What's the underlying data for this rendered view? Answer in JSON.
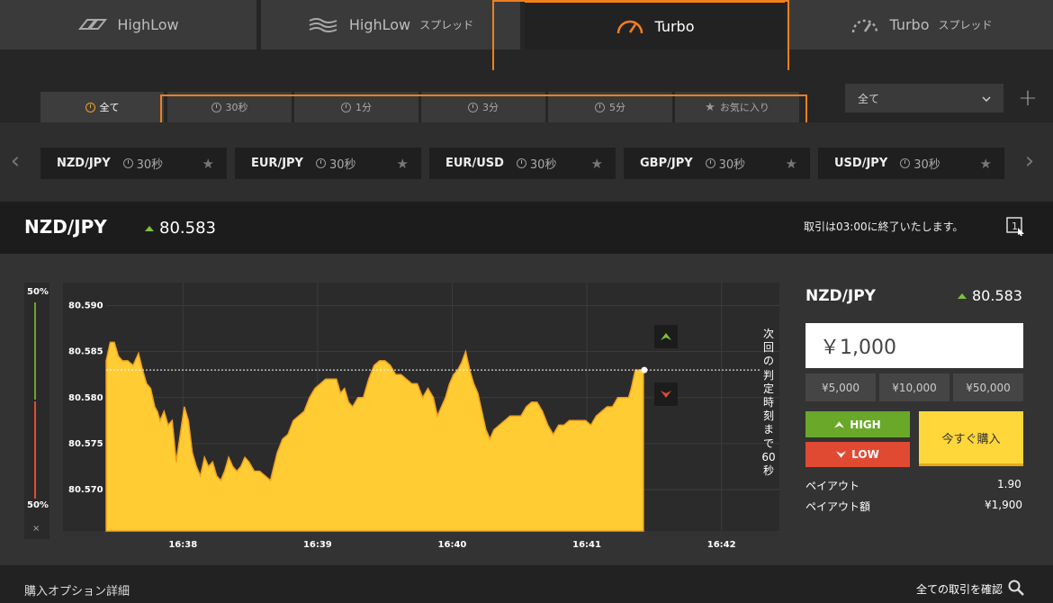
{
  "product_tabs": [
    {
      "label": "HighLow",
      "sub": ""
    },
    {
      "label": "HighLow",
      "sub": "スプレッド"
    },
    {
      "label": "Turbo",
      "sub": ""
    },
    {
      "label": "Turbo",
      "sub": "スプレッド"
    }
  ],
  "expiry_tabs": [
    "全て",
    "30秒",
    "1分",
    "3分",
    "5分",
    "お気に入り"
  ],
  "filter_select": "全て",
  "assets": [
    {
      "symbol": "NZD/JPY",
      "duration": "30秒"
    },
    {
      "symbol": "EUR/JPY",
      "duration": "30秒"
    },
    {
      "symbol": "EUR/USD",
      "duration": "30秒"
    },
    {
      "symbol": "GBP/JPY",
      "duration": "30秒"
    },
    {
      "symbol": "USD/JPY",
      "duration": "30秒"
    }
  ],
  "header": {
    "symbol": "NZD/JPY",
    "rate": "80.583",
    "message": "取引は03:00に終了いたします。"
  },
  "sentiment": {
    "up": "50%",
    "down": "50%",
    "close": "×"
  },
  "countdown_text": "次回の判定時刻まで60秒",
  "chart_data": {
    "type": "area",
    "y_ticks": [
      "80.590",
      "80.585",
      "80.580",
      "80.575",
      "80.570"
    ],
    "x_ticks": [
      "16:38",
      "16:39",
      "16:40",
      "16:41",
      "16:42"
    ],
    "ylim": [
      80.5655,
      80.5925
    ],
    "x_range_minutes": [
      0,
      5.0
    ],
    "strike_level": 80.583,
    "series": [
      {
        "color": "#ffcc33",
        "points": [
          [
            0.0,
            80.584
          ],
          [
            0.03,
            80.586
          ],
          [
            0.06,
            80.586
          ],
          [
            0.09,
            80.5845
          ],
          [
            0.12,
            80.584
          ],
          [
            0.16,
            80.584
          ],
          [
            0.2,
            80.5835
          ],
          [
            0.24,
            80.5848
          ],
          [
            0.27,
            80.583
          ],
          [
            0.3,
            80.5815
          ],
          [
            0.33,
            80.581
          ],
          [
            0.36,
            80.579
          ],
          [
            0.38,
            80.5785
          ],
          [
            0.4,
            80.5775
          ],
          [
            0.43,
            80.5785
          ],
          [
            0.46,
            80.577
          ],
          [
            0.49,
            80.5775
          ],
          [
            0.52,
            80.573
          ],
          [
            0.55,
            80.576
          ],
          [
            0.58,
            80.579
          ],
          [
            0.61,
            80.5775
          ],
          [
            0.64,
            80.574
          ],
          [
            0.67,
            80.5725
          ],
          [
            0.7,
            80.5715
          ],
          [
            0.73,
            80.5735
          ],
          [
            0.76,
            80.5725
          ],
          [
            0.79,
            80.573
          ],
          [
            0.82,
            80.5715
          ],
          [
            0.85,
            80.571
          ],
          [
            0.88,
            80.572
          ],
          [
            0.91,
            80.5735
          ],
          [
            0.94,
            80.5725
          ],
          [
            0.97,
            80.572
          ],
          [
            1.0,
            80.5725
          ],
          [
            1.03,
            80.5735
          ],
          [
            1.06,
            80.573
          ],
          [
            1.1,
            80.572
          ],
          [
            1.14,
            80.572
          ],
          [
            1.18,
            80.5715
          ],
          [
            1.22,
            80.571
          ],
          [
            1.27,
            80.574
          ],
          [
            1.31,
            80.5755
          ],
          [
            1.35,
            80.576
          ],
          [
            1.39,
            80.5775
          ],
          [
            1.43,
            80.578
          ],
          [
            1.47,
            80.5785
          ],
          [
            1.51,
            80.58
          ],
          [
            1.55,
            80.581
          ],
          [
            1.59,
            80.5815
          ],
          [
            1.63,
            80.582
          ],
          [
            1.67,
            80.582
          ],
          [
            1.71,
            80.582
          ],
          [
            1.74,
            80.5805
          ],
          [
            1.77,
            80.581
          ],
          [
            1.8,
            80.5795
          ],
          [
            1.83,
            80.579
          ],
          [
            1.87,
            80.58
          ],
          [
            1.91,
            80.58
          ],
          [
            1.95,
            80.582
          ],
          [
            1.99,
            80.5835
          ],
          [
            2.03,
            80.584
          ],
          [
            2.07,
            80.584
          ],
          [
            2.11,
            80.5835
          ],
          [
            2.15,
            80.5825
          ],
          [
            2.19,
            80.5825
          ],
          [
            2.23,
            80.582
          ],
          [
            2.27,
            80.5815
          ],
          [
            2.31,
            80.5815
          ],
          [
            2.35,
            80.58
          ],
          [
            2.39,
            80.581
          ],
          [
            2.43,
            80.58
          ],
          [
            2.46,
            80.578
          ],
          [
            2.49,
            80.579
          ],
          [
            2.52,
            80.58
          ],
          [
            2.55,
            80.5815
          ],
          [
            2.58,
            80.5825
          ],
          [
            2.61,
            80.583
          ],
          [
            2.64,
            80.5838
          ],
          [
            2.67,
            80.585
          ],
          [
            2.7,
            80.583
          ],
          [
            2.73,
            80.5815
          ],
          [
            2.76,
            80.5805
          ],
          [
            2.79,
            80.5785
          ],
          [
            2.82,
            80.5765
          ],
          [
            2.85,
            80.5755
          ],
          [
            2.88,
            80.5765
          ],
          [
            2.92,
            80.577
          ],
          [
            2.96,
            80.5775
          ],
          [
            3.0,
            80.578
          ],
          [
            3.04,
            80.578
          ],
          [
            3.08,
            80.578
          ],
          [
            3.12,
            80.579
          ],
          [
            3.16,
            80.5795
          ],
          [
            3.2,
            80.5795
          ],
          [
            3.24,
            80.5785
          ],
          [
            3.28,
            80.577
          ],
          [
            3.32,
            80.576
          ],
          [
            3.36,
            80.577
          ],
          [
            3.4,
            80.577
          ],
          [
            3.44,
            80.5775
          ],
          [
            3.48,
            80.5775
          ],
          [
            3.52,
            80.5775
          ],
          [
            3.56,
            80.5775
          ],
          [
            3.6,
            80.577
          ],
          [
            3.64,
            80.578
          ],
          [
            3.68,
            80.5785
          ],
          [
            3.72,
            80.579
          ],
          [
            3.76,
            80.579
          ],
          [
            3.8,
            80.58
          ],
          [
            3.84,
            80.58
          ],
          [
            3.88,
            80.58
          ],
          [
            3.9,
            80.581
          ],
          [
            3.93,
            80.583
          ],
          [
            3.96,
            80.583
          ],
          [
            3.99,
            80.583
          ]
        ]
      }
    ],
    "grid": true
  },
  "indicators": {
    "up_icon": "chevron-up-icon",
    "down_icon": "chevron-down-icon"
  },
  "trade_panel": {
    "symbol": "NZD/JPY",
    "rate": "80.583",
    "amount": "￥1,000",
    "quick_amounts": [
      "¥5,000",
      "¥10,000",
      "¥50,000"
    ],
    "high_label": "HIGH",
    "low_label": "LOW",
    "buy_label": "今すぐ購入",
    "payout_label": "ペイアウト",
    "payout_value": "1.90",
    "payout_amount_label": "ペイアウト額",
    "payout_amount_value": "¥1,900"
  },
  "footer": {
    "left": "購入オプション詳細",
    "right": "全ての取引を確認"
  },
  "colors": {
    "accent": "#f07f1e",
    "high": "#6aa82a",
    "low": "#e04a33",
    "buy": "#ffd73a",
    "area": "#ffcc33"
  }
}
